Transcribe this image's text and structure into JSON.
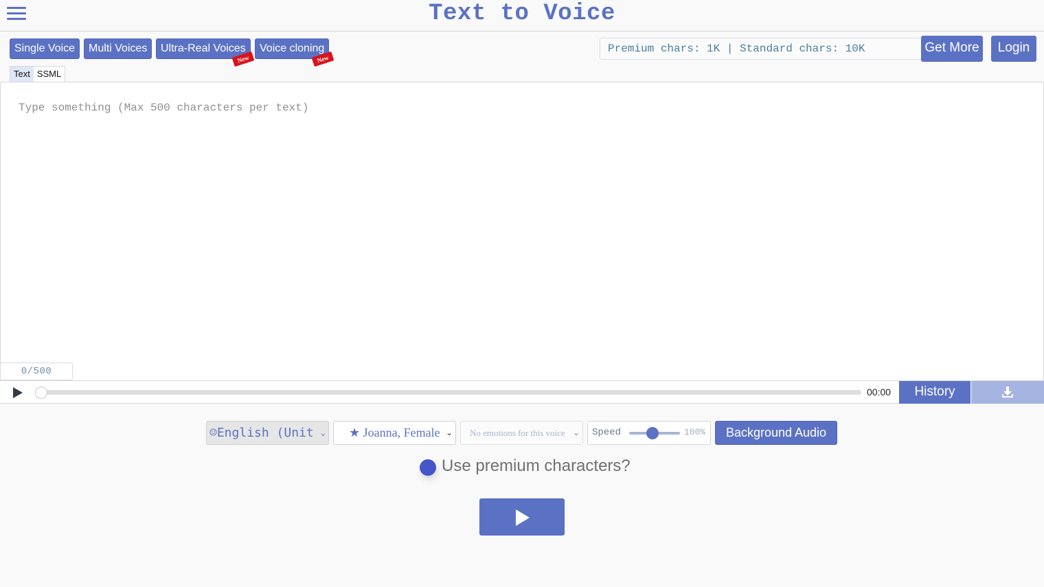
{
  "header": {
    "title": "Text to Voice",
    "menu_icon": "hamburger-menu-icon"
  },
  "modes": [
    {
      "label": "Single Voice",
      "badge": null
    },
    {
      "label": "Multi Voices",
      "badge": null
    },
    {
      "label": "Ultra-Real Voices",
      "badge": "New"
    },
    {
      "label": "Voice cloning",
      "badge": "New"
    }
  ],
  "account": {
    "chars_info": "Premium chars: 1K | Standard chars: 10K",
    "get_more_label": "Get More",
    "login_label": "Login"
  },
  "editor": {
    "tabs": [
      {
        "label": "Text",
        "active": true
      },
      {
        "label": "SSML",
        "active": false
      }
    ],
    "value": "",
    "placeholder": "Type something (Max 500 characters per text)",
    "counter": "0/500"
  },
  "player": {
    "play_icon": "play-icon",
    "time": "00:00",
    "progress": 0,
    "history_label": "History",
    "download_icon": "download-icon"
  },
  "controls": {
    "language": {
      "icon": "smiley-icon",
      "selected": "English (United States)",
      "visible_text": "English (Unit"
    },
    "voice": {
      "icon": "star-icon",
      "selected": "Joanna, Female"
    },
    "emotion": {
      "selected": "No emotions for this voice"
    },
    "speed": {
      "label": "Speed",
      "value_percent": 100,
      "value_text": "100%"
    },
    "background_audio_label": "Background Audio"
  },
  "premium": {
    "label": "Use premium characters?",
    "checked": false
  },
  "generate": {
    "icon": "play-icon"
  },
  "colors": {
    "accent": "#5b72c4",
    "badge": "#d8141c",
    "background": "#f9f9f9",
    "download_disabled": "#a6b4e2"
  }
}
